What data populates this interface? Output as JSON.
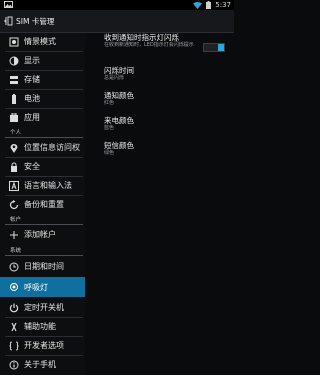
{
  "status_bar": {
    "time": "5:37"
  },
  "app_bar": {
    "title": "SIM 卡管理"
  },
  "sidebar": {
    "items": [
      {
        "label": "情景模式",
        "icon": "speaker-icon"
      },
      {
        "label": "显示",
        "icon": "brightness-icon"
      },
      {
        "label": "存储",
        "icon": "storage-icon"
      },
      {
        "label": "电池",
        "icon": "battery-icon"
      },
      {
        "label": "应用",
        "icon": "apps-icon"
      },
      {
        "label": "位置信息访问权",
        "icon": "location-icon"
      },
      {
        "label": "安全",
        "icon": "lock-icon"
      },
      {
        "label": "语言和输入法",
        "icon": "language-icon"
      },
      {
        "label": "备份和重置",
        "icon": "backup-icon"
      },
      {
        "label": "添加帐户",
        "icon": "add-icon"
      },
      {
        "label": "日期和时间",
        "icon": "clock-icon"
      },
      {
        "label": "呼吸灯",
        "icon": "notification-light-icon"
      },
      {
        "label": "定时开关机",
        "icon": "power-schedule-icon"
      },
      {
        "label": "辅助功能",
        "icon": "accessibility-icon"
      },
      {
        "label": "开发者选项",
        "icon": "developer-icon"
      },
      {
        "label": "关于手机",
        "icon": "info-icon"
      }
    ],
    "sections": {
      "personal": "个人",
      "accounts": "帐户",
      "system": "系统"
    }
  },
  "detail": {
    "prefs": [
      {
        "title": "收到通知时指示灯闪烁",
        "summary": "在收到新通知时，LED指示灯会闪烁提示",
        "toggle_on": true
      },
      {
        "title": "闪烁时间",
        "summary": "总是闪烁"
      },
      {
        "title": "通知颜色",
        "summary": "红色"
      },
      {
        "title": "来电颜色",
        "summary": "蓝色"
      },
      {
        "title": "短信颜色",
        "summary": "绿色"
      }
    ]
  },
  "colors": {
    "accent": "#0f6f9e",
    "toggle_on": "#2fa6d9"
  }
}
